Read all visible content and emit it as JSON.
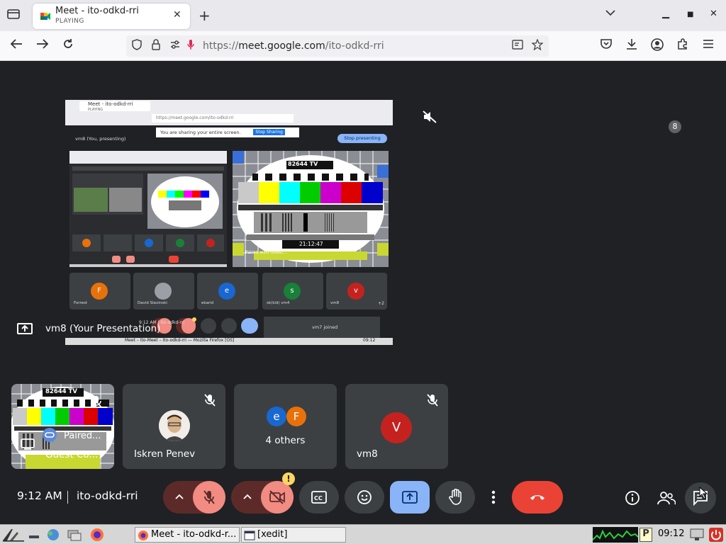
{
  "browser": {
    "tab": {
      "title": "Meet - ito-odkd-rri",
      "status": "PLAYING"
    },
    "url": {
      "prefix": "https://",
      "domain": "meet.google.com",
      "path": "/ito-odkd-rri"
    }
  },
  "shared_screen": {
    "tab_title": "Meet - ito-odkd-rri",
    "tab_sub": "PLAYING",
    "url": "https://meet.google.com/ito-odkd-rri",
    "sharing_banner": "You are sharing your entire screen.",
    "stop_sharing": "Stop Sharing",
    "presenting_label": "vm8 (You, presenting)",
    "stop_presenting": "Stop presenting",
    "tv_label": "82644 TV",
    "tv_time": "21:12:47",
    "paired_label": "Paired with Guest...",
    "participants": [
      {
        "initial": "F",
        "name": "Forrest",
        "color": "#e8710a"
      },
      {
        "initial": "",
        "name": "David Slavinski",
        "color": "#5f6368"
      },
      {
        "initial": "e",
        "name": "ekarid",
        "color": "#1967d2"
      },
      {
        "initial": "s",
        "name": "sk(kid) vm4",
        "color": "#188038"
      },
      {
        "initial": "v",
        "name": "vm8",
        "color": "#c5221f"
      }
    ],
    "extra_count": "+2",
    "join_toast": "vm7 joined",
    "clock": "9:12 AM",
    "code": "ito-odkd-rri",
    "taskbar_text": "Meet – ito-Meet – ito-odkd-rri — Mozilla Firefox [OS]",
    "taskbar_clock": "09:12"
  },
  "presentation": {
    "label": "vm8 (Your Presentation)"
  },
  "tiles": [
    {
      "name": "Guest Co...",
      "overlay": "Paired...",
      "tv_label": "82644 TV"
    },
    {
      "name": "Iskren Penev"
    },
    {
      "name": "4 others",
      "avatars": [
        {
          "initial": "e",
          "color": "#1967d2"
        },
        {
          "initial": "F",
          "color": "#e8710a"
        }
      ]
    },
    {
      "name": "vm8",
      "avatar": {
        "initial": "V",
        "color": "#c5221f"
      }
    }
  ],
  "meeting": {
    "time": "9:12 AM",
    "code": "ito-odkd-rri",
    "participant_count": "8"
  },
  "taskbar": {
    "firefox_window": "Meet - ito-odkd-r...",
    "xedit_window": "[xedit]",
    "clock": "09:12"
  },
  "colors": {
    "background": "#202124",
    "tile": "#3c4043",
    "mic_off": "#f28b82",
    "present_active": "#8ab4f8",
    "hangup": "#ea4335",
    "warning": "#fdd663"
  }
}
